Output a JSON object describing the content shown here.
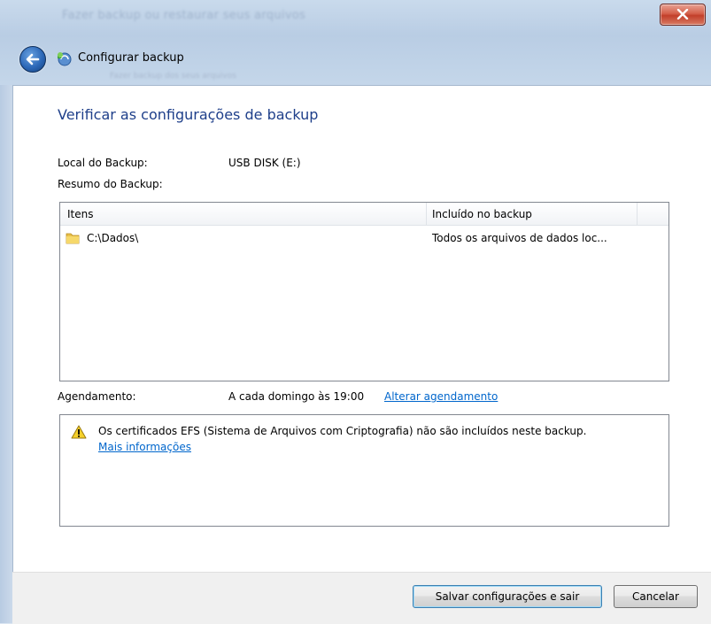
{
  "window": {
    "title": "Fazer backup ou restaurar seus arquivos",
    "subtitle": "Fazer backup dos seus arquivos",
    "nav_title": "Configurar backup"
  },
  "page": {
    "heading": "Verificar as configurações de backup",
    "local_label": "Local do Backup:",
    "local_value": "USB DISK (E:)",
    "summary_label": "Resumo do Backup:",
    "schedule_label": "Agendamento:",
    "schedule_value": "A cada domingo às 19:00",
    "schedule_link": "Alterar agendamento"
  },
  "table": {
    "columns": [
      "Itens",
      "Incluído no backup"
    ],
    "rows": [
      {
        "item": "C:\\Dados\\",
        "included": "Todos os arquivos de dados loc..."
      }
    ]
  },
  "warning": {
    "text": "Os certificados EFS (Sistema de Arquivos com Criptografia) não são incluídos neste backup.",
    "link": "Mais informações"
  },
  "buttons": {
    "save": "Salvar configurações e sair",
    "cancel": "Cancelar"
  },
  "colors": {
    "heading": "#1e3f8a",
    "link": "#0066cc",
    "close_button": "#c23f2a"
  },
  "icons": [
    "back-arrow-icon",
    "backup-icon",
    "close-icon",
    "folder-icon",
    "warning-icon"
  ]
}
